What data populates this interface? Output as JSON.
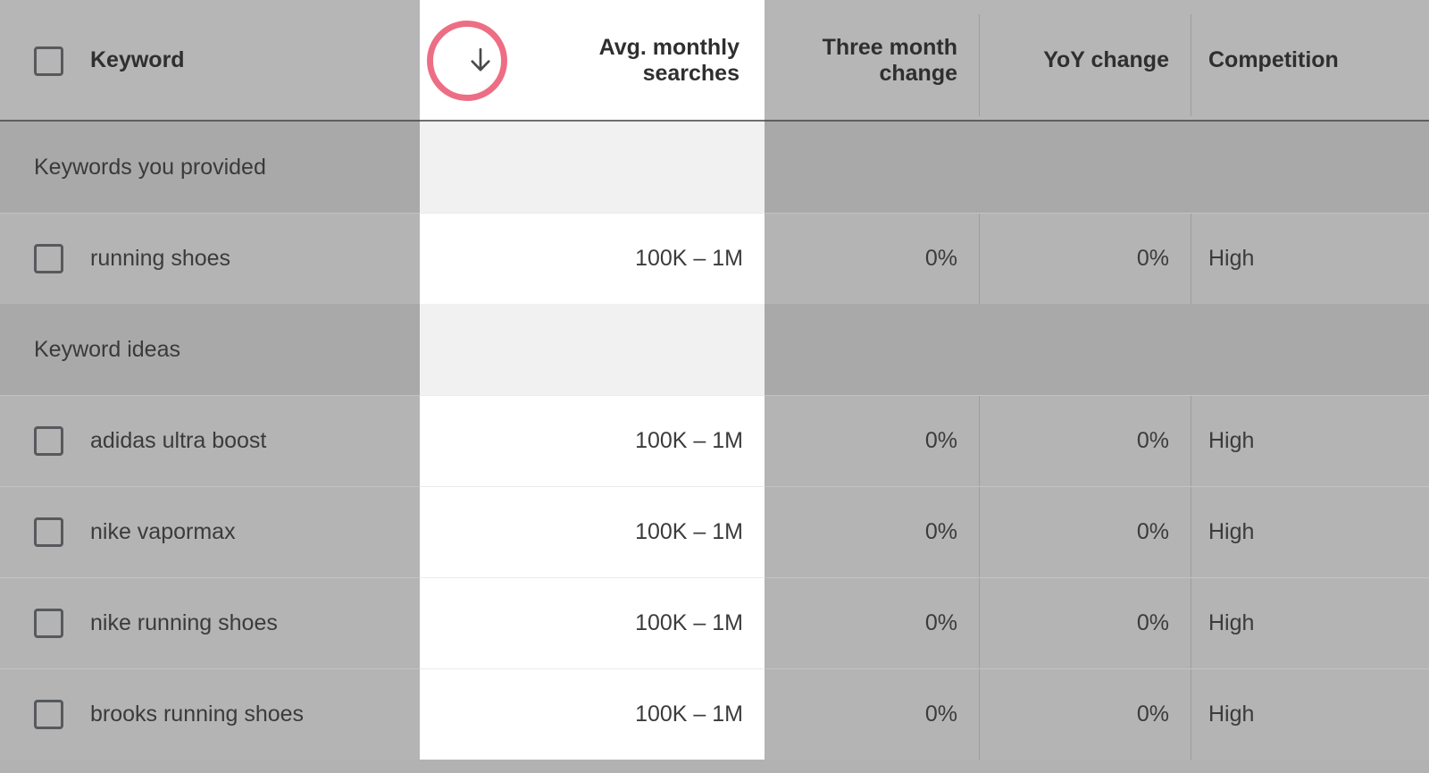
{
  "table": {
    "columns": [
      {
        "id": "keyword",
        "label": "Keyword",
        "align": "left",
        "sorted": false
      },
      {
        "id": "searches",
        "label": "Avg. monthly\nsearches",
        "label_line1": "Avg. monthly",
        "label_line2": "searches",
        "align": "right",
        "sorted": true,
        "sort_direction": "descending",
        "sort_icon": "arrow-down-icon"
      },
      {
        "id": "three_month",
        "label_line1": "Three month",
        "label_line2": "change",
        "align": "right",
        "sorted": false
      },
      {
        "id": "yoy",
        "label": "YoY change",
        "align": "right",
        "sorted": false
      },
      {
        "id": "competition",
        "label": "Competition",
        "align": "left",
        "sorted": false
      }
    ],
    "groups": [
      {
        "label": "Keywords you provided",
        "rows": [
          {
            "checkbox": "unchecked",
            "keyword": "running shoes",
            "searches": "100K – 1M",
            "three_month": "0%",
            "yoy": "0%",
            "competition": "High"
          }
        ]
      },
      {
        "label": "Keyword ideas",
        "rows": [
          {
            "checkbox": "unchecked",
            "keyword": "adidas ultra boost",
            "searches": "100K – 1M",
            "three_month": "0%",
            "yoy": "0%",
            "competition": "High"
          },
          {
            "checkbox": "unchecked",
            "keyword": "nike vapormax",
            "searches": "100K – 1M",
            "three_month": "0%",
            "yoy": "0%",
            "competition": "High"
          },
          {
            "checkbox": "unchecked",
            "keyword": "nike running shoes",
            "searches": "100K – 1M",
            "three_month": "0%",
            "yoy": "0%",
            "competition": "High"
          },
          {
            "checkbox": "unchecked",
            "keyword": "brooks running shoes",
            "searches": "100K – 1M",
            "three_month": "0%",
            "yoy": "0%",
            "competition": "High"
          }
        ]
      }
    ],
    "select_all_checkbox": "unchecked",
    "annotation": {
      "shape": "circle",
      "target": "sort-arrow-icon",
      "color": "#ed6e84"
    },
    "colors": {
      "row_background": "#b4b4b4",
      "group_background": "#a9a9a9",
      "sorted_column_background": "#ffffff",
      "sorted_column_group_background": "#f1f1f1",
      "header_background": "#b6b6b6",
      "text": "#3b3b3b",
      "annotation": "#ed6e84"
    }
  }
}
